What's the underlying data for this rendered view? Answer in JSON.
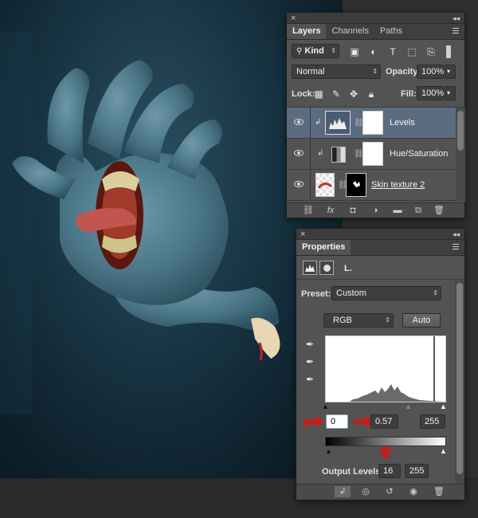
{
  "layers_panel": {
    "tabs": [
      "Layers",
      "Channels",
      "Paths"
    ],
    "filter_kind": "Kind",
    "blend_mode": "Normal",
    "opacity_label": "Opacity:",
    "opacity_value": "100%",
    "lock_label": "Lock:",
    "fill_label": "Fill:",
    "fill_value": "100%",
    "layers": [
      {
        "name": "Levels",
        "selected": true
      },
      {
        "name": "Hue/Saturation",
        "selected": false
      },
      {
        "name": "Skin texture 2",
        "selected": false
      }
    ]
  },
  "properties_panel": {
    "tab": "Properties",
    "header_label": "L.",
    "preset_label": "Preset:",
    "preset_value": "Custom",
    "channel": "RGB",
    "auto_label": "Auto",
    "input_black": "0",
    "input_gamma": "0.57",
    "input_white": "255",
    "output_label": "Output Levels:",
    "output_black": "16",
    "output_white": "255"
  },
  "colors": {
    "panel_bg": "#535353",
    "selected_row": "#5b6c80",
    "annotation_arrow": "#c0201d"
  }
}
